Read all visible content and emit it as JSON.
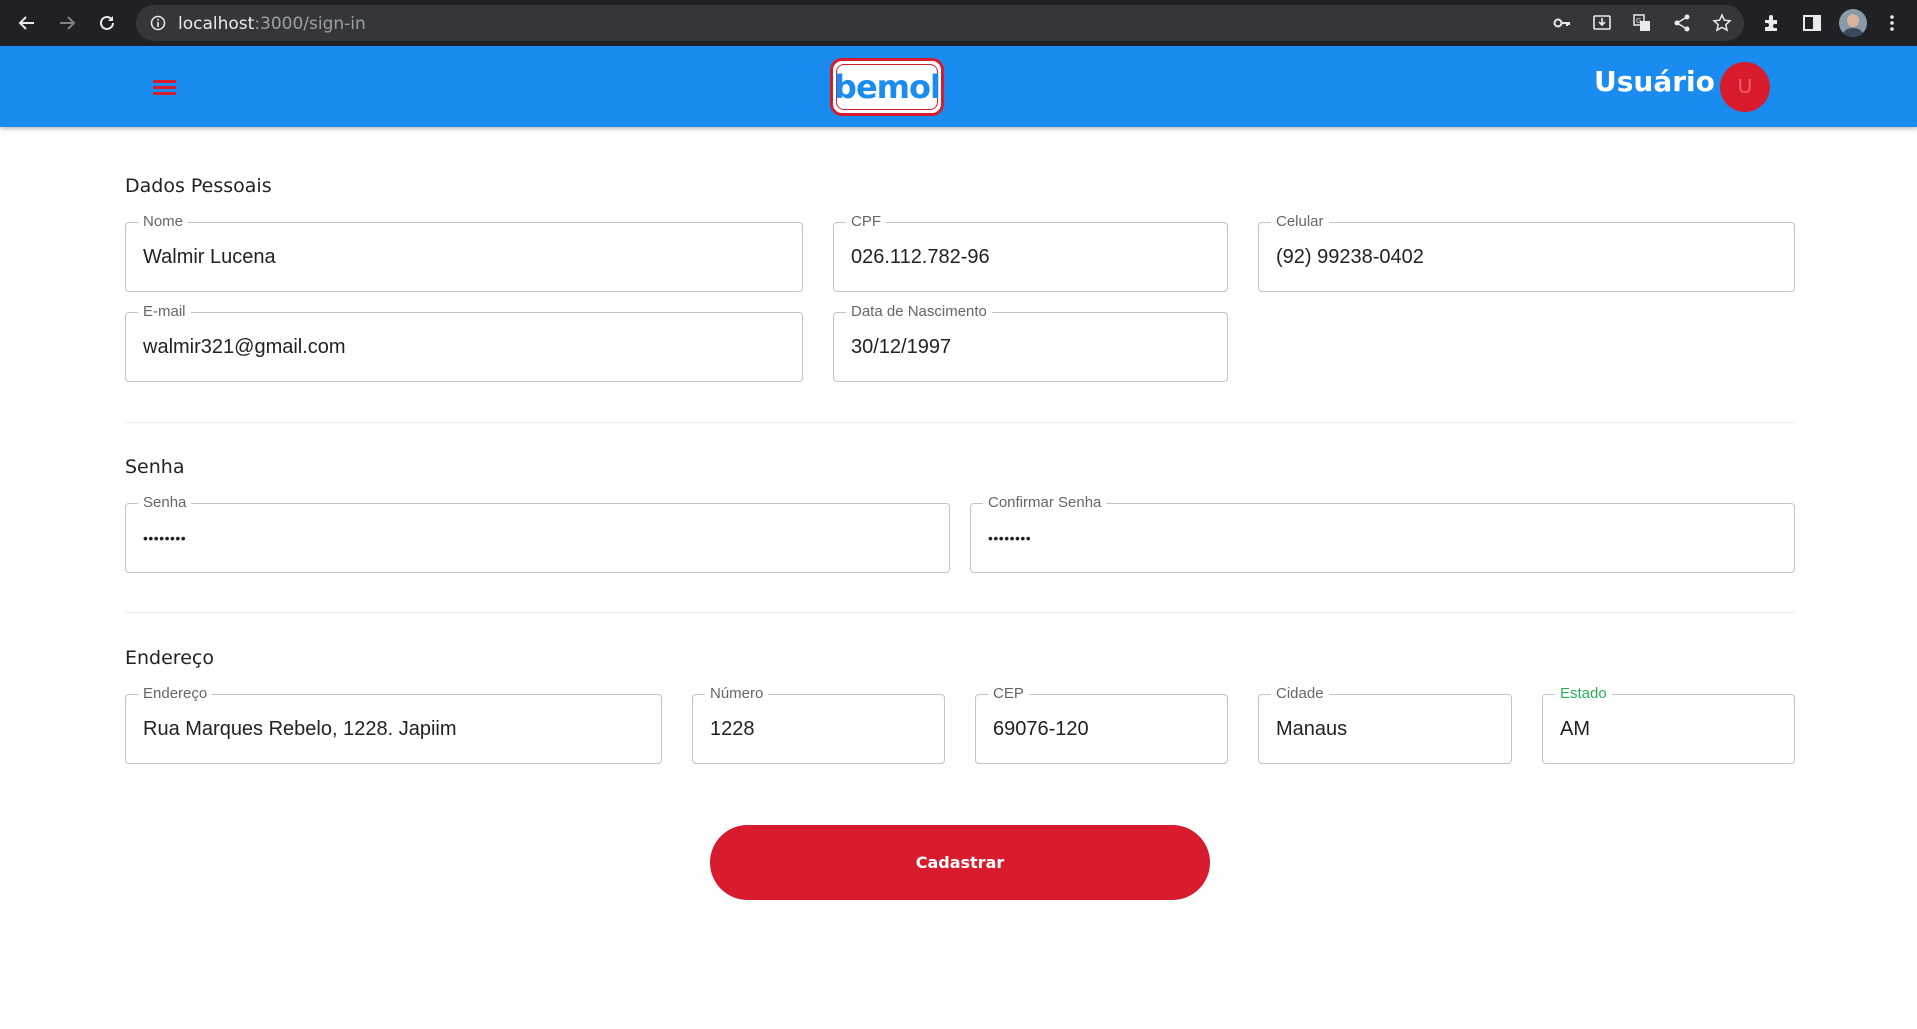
{
  "browser": {
    "url_host": "localhost",
    "url_path": ":3000/sign-in"
  },
  "header": {
    "logo_text": "bemol",
    "user_label": "Usuário",
    "avatar_initial": "U",
    "colors": {
      "bar": "#1a8cf0",
      "accent": "#d81b2d"
    }
  },
  "personal": {
    "title": "Dados Pessoais",
    "nome": {
      "label": "Nome",
      "value": "Walmir Lucena"
    },
    "cpf": {
      "label": "CPF",
      "value": "026.112.782-96"
    },
    "celular": {
      "label": "Celular",
      "value": "(92) 99238-0402"
    },
    "email": {
      "label": "E-mail",
      "value": "walmir321@gmail.com"
    },
    "nascimento": {
      "label": "Data de Nascimento",
      "value": "30/12/1997"
    }
  },
  "password": {
    "title": "Senha",
    "senha": {
      "label": "Senha",
      "value": "••••••••"
    },
    "confirmar": {
      "label": "Confirmar Senha",
      "value": "••••••••"
    }
  },
  "address": {
    "title": "Endereço",
    "endereco": {
      "label": "Endereço",
      "value": "Rua Marques Rebelo, 1228. Japiim"
    },
    "numero": {
      "label": "Número",
      "value": "1228"
    },
    "cep": {
      "label": "CEP",
      "value": "69076-120"
    },
    "cidade": {
      "label": "Cidade",
      "value": "Manaus"
    },
    "estado": {
      "label": "Estado",
      "value": "AM"
    }
  },
  "submit_label": "Cadastrar"
}
